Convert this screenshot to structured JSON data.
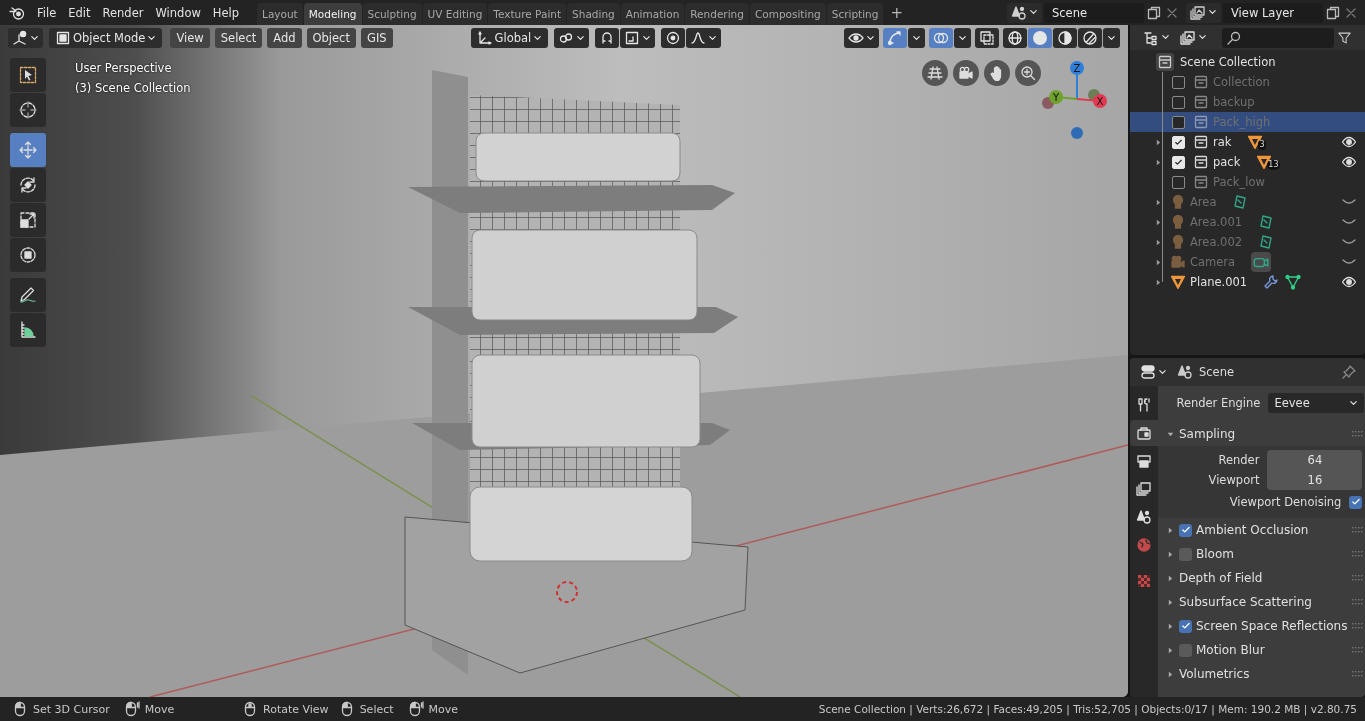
{
  "top_bar": {
    "menus": [
      "File",
      "Edit",
      "Render",
      "Window",
      "Help"
    ],
    "workspaces": [
      {
        "label": "Layout",
        "selected": false
      },
      {
        "label": "Modeling",
        "selected": true
      },
      {
        "label": "Sculpting",
        "selected": false
      },
      {
        "label": "UV Editing",
        "selected": false
      },
      {
        "label": "Texture Paint",
        "selected": false
      },
      {
        "label": "Shading",
        "selected": false
      },
      {
        "label": "Animation",
        "selected": false
      },
      {
        "label": "Rendering",
        "selected": false
      },
      {
        "label": "Compositing",
        "selected": false
      },
      {
        "label": "Scripting",
        "selected": false
      }
    ],
    "add_workspace": "+",
    "scene": "Scene",
    "view_layer": "View Layer"
  },
  "viewport": {
    "mode": "Object Mode",
    "menus": [
      "View",
      "Select",
      "Add",
      "Object",
      "GIS"
    ],
    "orientation": "Global",
    "snap": {
      "on": false
    },
    "proportional": {
      "on": false
    },
    "toggles": [
      {
        "kind": "gizmo",
        "on": true
      },
      {
        "kind": "overlay",
        "on": true
      },
      {
        "kind": "xray",
        "on": false
      }
    ],
    "shading_modes": [
      {
        "kind": "wireframe",
        "selected": false
      },
      {
        "kind": "solid",
        "selected": true
      },
      {
        "kind": "material",
        "selected": false
      },
      {
        "kind": "rendered",
        "selected": false
      }
    ],
    "info": [
      "User Perspective",
      "(3) Scene Collection"
    ],
    "tool_groups": [
      {
        "tools": [
          {
            "kind": "select",
            "selected": false
          },
          {
            "kind": "cursor",
            "selected": false
          }
        ]
      },
      {
        "tools": [
          {
            "kind": "move",
            "selected": true
          },
          {
            "kind": "rotate",
            "selected": false
          },
          {
            "kind": "scale",
            "selected": false
          },
          {
            "kind": "transform",
            "selected": false
          }
        ]
      },
      {
        "tools": [
          {
            "kind": "annotate",
            "selected": false
          },
          {
            "kind": "measure",
            "selected": false
          }
        ]
      }
    ],
    "axis_gizmo": [
      {
        "label": "Z",
        "color": "#2e7fd9"
      },
      {
        "label": "Y",
        "color": "#6ea22c"
      },
      {
        "label": "X",
        "color": "#e23a52"
      }
    ]
  },
  "outliner": {
    "root": {
      "name": "Scene Collection",
      "selected": false,
      "children": [
        {
          "name": "Collection",
          "kind": "collection",
          "checked": false,
          "dimmed": true,
          "selected": false
        },
        {
          "name": "backup",
          "kind": "collection",
          "checked": false,
          "dimmed": true,
          "selected": false
        },
        {
          "name": "Pack_high",
          "kind": "collection",
          "checked": false,
          "dimmed": true,
          "selected": true
        },
        {
          "name": "rak",
          "kind": "collection",
          "checked": true,
          "dimmed": false,
          "selected": false,
          "expanded": false,
          "data_icons": [
            {
              "kind": "mesh",
              "count": "3"
            }
          ],
          "visible": true
        },
        {
          "name": "pack",
          "kind": "collection",
          "checked": true,
          "dimmed": false,
          "selected": false,
          "expanded": false,
          "data_icons": [
            {
              "kind": "mesh",
              "count": "13"
            }
          ],
          "visible": true
        },
        {
          "name": "Pack_low",
          "kind": "collection",
          "checked": false,
          "dimmed": true,
          "selected": false
        },
        {
          "name": "Area",
          "kind": "light",
          "dimmed": true,
          "selected": false,
          "expanded": false,
          "data_icons": [
            {
              "kind": "light_data"
            }
          ],
          "visible": false
        },
        {
          "name": "Area.001",
          "kind": "light",
          "dimmed": true,
          "selected": false,
          "expanded": false,
          "data_icons": [
            {
              "kind": "light_data"
            }
          ],
          "visible": false
        },
        {
          "name": "Area.002",
          "kind": "light",
          "dimmed": true,
          "selected": false,
          "expanded": false,
          "data_icons": [
            {
              "kind": "light_data"
            }
          ],
          "visible": false
        },
        {
          "name": "Camera",
          "kind": "camera",
          "dimmed": true,
          "selected": false,
          "expanded": false,
          "data_icons": [
            {
              "kind": "camera_data"
            }
          ],
          "visible": false
        },
        {
          "name": "Plane.001",
          "kind": "mesh",
          "dimmed": false,
          "selected": false,
          "expanded": false,
          "data_icons": [
            {
              "kind": "modifier"
            },
            {
              "kind": "mesh_data"
            }
          ],
          "visible": true
        }
      ]
    }
  },
  "properties": {
    "context": "Scene",
    "tab_groups": [
      {
        "tabs": [
          {
            "kind": "tool",
            "selected": false
          },
          {
            "kind": "render",
            "selected": true
          },
          {
            "kind": "output",
            "selected": false
          },
          {
            "kind": "view_layer",
            "selected": false
          },
          {
            "kind": "scene",
            "selected": false
          },
          {
            "kind": "world",
            "selected": false
          }
        ]
      },
      {
        "tabs": [
          {
            "kind": "texture",
            "selected": false
          }
        ]
      }
    ],
    "render_engine": {
      "label": "Render Engine",
      "value": "Eevee"
    },
    "panels": [
      {
        "label": "Sampling",
        "expanded": true,
        "fields": [
          {
            "kind": "number",
            "label": "Render",
            "value": "64"
          },
          {
            "kind": "number",
            "label": "Viewport",
            "value": "16"
          },
          {
            "kind": "checkbox",
            "label": "Viewport Denoising",
            "checked": true
          }
        ]
      },
      {
        "label": "Ambient Occlusion",
        "expanded": false,
        "checked": true
      },
      {
        "label": "Bloom",
        "expanded": false,
        "checked": false
      },
      {
        "label": "Depth of Field",
        "expanded": false
      },
      {
        "label": "Subsurface Scattering",
        "expanded": false
      },
      {
        "label": "Screen Space Reflections",
        "expanded": false,
        "checked": true
      },
      {
        "label": "Motion Blur",
        "expanded": false,
        "checked": false
      },
      {
        "label": "Volumetrics",
        "expanded": false
      }
    ]
  },
  "status_bar": {
    "hint_groups": [
      {
        "hints": [
          {
            "kind": "left_click",
            "label": "Set 3D Cursor"
          },
          {
            "kind": "drag",
            "label": "Move"
          }
        ]
      },
      {
        "hints": [
          {
            "kind": "middle_click",
            "label": "Rotate View"
          }
        ]
      },
      {
        "hints": [
          {
            "kind": "left_click",
            "label": "Select"
          },
          {
            "kind": "drag",
            "label": "Move"
          }
        ]
      }
    ],
    "stats": "Scene Collection | Verts:26,672 | Faces:49,205 | Tris:52,705 | Objects:0/17 | Mem: 190.2 MB | v2.80.75"
  }
}
